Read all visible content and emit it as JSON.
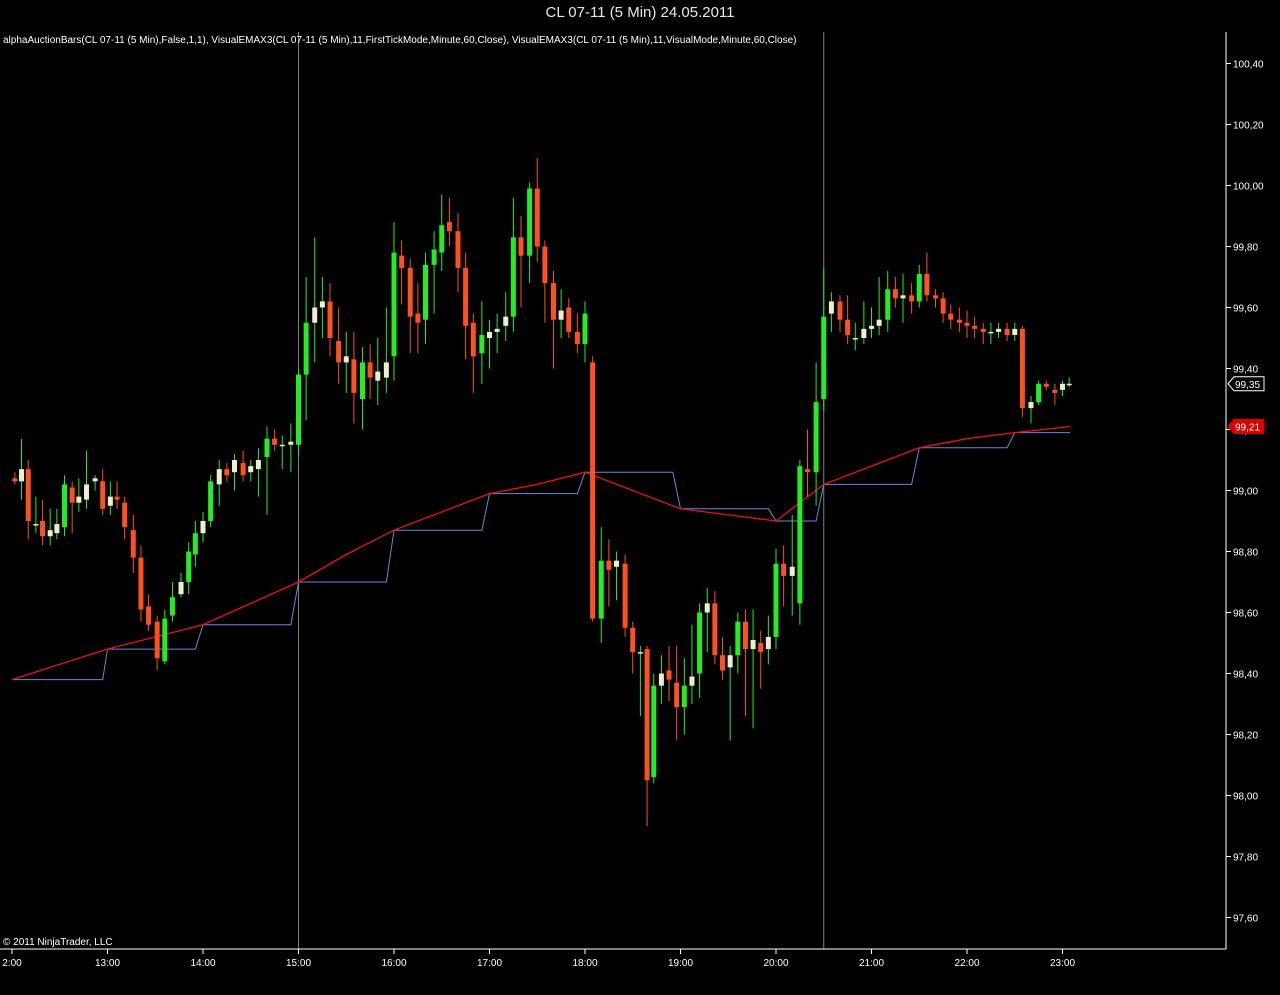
{
  "window": {
    "title": "CL 07-11 (5 Min)  24.05.2011"
  },
  "indicator_label": "alphaAuctionBars(CL 07-11 (5 Min),False,1,1), VisualEMAX3(CL 07-11 (5 Min),11,FirstTickMode,Minute,60,Close), VisualEMAX3(CL 07-11 (5 Min),11,VisualMode,Minute,60,Close)",
  "copyright": "© 2011 NinjaTrader, LLC",
  "colors": {
    "background": "#000000",
    "axis": "#ffffff",
    "session_line": "#808080",
    "bull_strong": "#22ee22",
    "bull_light": "#eeeecc",
    "bear": "#ff5020",
    "ema_first_tick": "#6688dd",
    "ema_visual": "#ee1111",
    "price_marker": "#ffffff",
    "ema_marker": "#dd0000"
  },
  "chart_data": {
    "type": "candlestick",
    "title": "CL 07-11 (5 Min)  24.05.2011",
    "symbol": "CL 07-11",
    "interval": "5 Min",
    "date": "24.05.2011",
    "y_ticks": [
      "100,40",
      "100,20",
      "100,00",
      "99,80",
      "99,60",
      "99,40",
      "99,20",
      "99,00",
      "98,80",
      "98,60",
      "98,40",
      "98,20",
      "98,00",
      "97,80",
      "97,60"
    ],
    "y_tick_values": [
      100.4,
      100.2,
      100.0,
      99.8,
      99.6,
      99.4,
      99.2,
      99.0,
      98.8,
      98.6,
      98.4,
      98.2,
      98.0,
      97.8,
      97.6
    ],
    "x_ticks": [
      "2:00",
      "13:00",
      "14:00",
      "15:00",
      "16:00",
      "17:00",
      "18:00",
      "19:00",
      "20:00",
      "21:00",
      "22:00",
      "23:00"
    ],
    "x_tick_hours": [
      12,
      13,
      14,
      15,
      16,
      17,
      18,
      19,
      20,
      21,
      22,
      23
    ],
    "x_range_hours": [
      12.0,
      24.3
    ],
    "y_range": [
      97.49,
      100.5
    ],
    "session_lines_hours": [
      15.0,
      20.5
    ],
    "last_price": {
      "value": 99.35,
      "label": "99,35"
    },
    "ema_value": {
      "value": 99.21,
      "label": "99,21"
    },
    "ema_first_tick": [
      [
        12.0,
        98.38
      ],
      [
        12.95,
        98.38
      ],
      [
        13.0,
        98.48
      ],
      [
        13.92,
        98.48
      ],
      [
        14.0,
        98.56
      ],
      [
        14.92,
        98.56
      ],
      [
        15.0,
        98.7
      ],
      [
        15.92,
        98.7
      ],
      [
        16.0,
        98.87
      ],
      [
        16.92,
        98.87
      ],
      [
        17.0,
        98.99
      ],
      [
        17.92,
        98.99
      ],
      [
        18.0,
        99.06
      ],
      [
        18.92,
        99.06
      ],
      [
        19.0,
        98.94
      ],
      [
        19.92,
        98.94
      ],
      [
        20.0,
        98.9
      ],
      [
        20.42,
        98.9
      ],
      [
        20.5,
        99.02
      ],
      [
        21.42,
        99.02
      ],
      [
        21.5,
        99.14
      ],
      [
        22.42,
        99.14
      ],
      [
        22.5,
        99.19
      ],
      [
        23.08,
        99.19
      ]
    ],
    "ema_visual": [
      [
        12.0,
        98.38
      ],
      [
        12.5,
        98.43
      ],
      [
        13.0,
        98.48
      ],
      [
        13.5,
        98.52
      ],
      [
        14.0,
        98.56
      ],
      [
        14.5,
        98.63
      ],
      [
        15.0,
        98.7
      ],
      [
        15.5,
        98.79
      ],
      [
        16.0,
        98.87
      ],
      [
        16.5,
        98.93
      ],
      [
        17.0,
        98.99
      ],
      [
        17.5,
        99.02
      ],
      [
        18.0,
        99.06
      ],
      [
        18.5,
        99.0
      ],
      [
        19.0,
        98.94
      ],
      [
        19.5,
        98.92
      ],
      [
        20.0,
        98.9
      ],
      [
        20.5,
        99.02
      ],
      [
        21.0,
        99.08
      ],
      [
        21.5,
        99.14
      ],
      [
        22.0,
        99.17
      ],
      [
        22.5,
        99.19
      ],
      [
        23.08,
        99.21
      ]
    ],
    "candles": [
      {
        "t": 12.03,
        "o": 99.04,
        "h": 99.06,
        "l": 99.02,
        "c": 99.03
      },
      {
        "t": 12.1,
        "o": 99.03,
        "h": 99.17,
        "l": 98.97,
        "c": 99.07
      },
      {
        "t": 12.17,
        "o": 99.07,
        "h": 99.1,
        "l": 98.84,
        "c": 98.9
      },
      {
        "t": 12.25,
        "o": 98.89,
        "h": 98.98,
        "l": 98.86,
        "c": 98.89
      },
      {
        "t": 12.32,
        "o": 98.9,
        "h": 98.97,
        "l": 98.82,
        "c": 98.85
      },
      {
        "t": 12.4,
        "o": 98.85,
        "h": 98.94,
        "l": 98.82,
        "c": 98.87
      },
      {
        "t": 12.47,
        "o": 98.86,
        "h": 98.94,
        "l": 98.84,
        "c": 98.89
      },
      {
        "t": 12.55,
        "o": 98.88,
        "h": 99.05,
        "l": 98.85,
        "c": 99.02
      },
      {
        "t": 12.63,
        "o": 99.01,
        "h": 99.03,
        "l": 98.86,
        "c": 98.96
      },
      {
        "t": 12.7,
        "o": 98.96,
        "h": 99.04,
        "l": 98.93,
        "c": 98.98
      },
      {
        "t": 12.78,
        "o": 98.97,
        "h": 99.13,
        "l": 98.94,
        "c": 99.02
      },
      {
        "t": 12.87,
        "o": 99.03,
        "h": 99.05,
        "l": 99.0,
        "c": 99.04
      },
      {
        "t": 12.95,
        "o": 99.03,
        "h": 99.07,
        "l": 98.92,
        "c": 98.94
      },
      {
        "t": 13.03,
        "o": 98.95,
        "h": 99.03,
        "l": 98.92,
        "c": 98.98
      },
      {
        "t": 13.1,
        "o": 98.98,
        "h": 99.03,
        "l": 98.94,
        "c": 98.97
      },
      {
        "t": 13.18,
        "o": 98.96,
        "h": 98.98,
        "l": 98.84,
        "c": 98.88
      },
      {
        "t": 13.27,
        "o": 98.87,
        "h": 98.92,
        "l": 98.73,
        "c": 98.78
      },
      {
        "t": 13.35,
        "o": 98.78,
        "h": 98.82,
        "l": 98.57,
        "c": 98.61
      },
      {
        "t": 13.43,
        "o": 98.62,
        "h": 98.66,
        "l": 98.54,
        "c": 98.56
      },
      {
        "t": 13.52,
        "o": 98.57,
        "h": 98.59,
        "l": 98.41,
        "c": 98.45
      },
      {
        "t": 13.6,
        "o": 98.44,
        "h": 98.61,
        "l": 98.43,
        "c": 98.58
      },
      {
        "t": 13.68,
        "o": 98.59,
        "h": 98.7,
        "l": 98.57,
        "c": 98.65
      },
      {
        "t": 13.77,
        "o": 98.66,
        "h": 98.73,
        "l": 98.65,
        "c": 98.7
      },
      {
        "t": 13.85,
        "o": 98.7,
        "h": 98.83,
        "l": 98.66,
        "c": 98.8
      },
      {
        "t": 13.92,
        "o": 98.79,
        "h": 98.9,
        "l": 98.75,
        "c": 98.86
      },
      {
        "t": 14.0,
        "o": 98.86,
        "h": 98.93,
        "l": 98.83,
        "c": 98.9
      },
      {
        "t": 14.08,
        "o": 98.9,
        "h": 99.05,
        "l": 98.88,
        "c": 99.03
      },
      {
        "t": 14.17,
        "o": 99.02,
        "h": 99.1,
        "l": 98.95,
        "c": 99.07
      },
      {
        "t": 14.25,
        "o": 99.07,
        "h": 99.09,
        "l": 99.03,
        "c": 99.05
      },
      {
        "t": 14.33,
        "o": 99.06,
        "h": 99.12,
        "l": 99.0,
        "c": 99.1
      },
      {
        "t": 14.42,
        "o": 99.09,
        "h": 99.13,
        "l": 99.03,
        "c": 99.05
      },
      {
        "t": 14.5,
        "o": 99.06,
        "h": 99.1,
        "l": 99.03,
        "c": 99.08
      },
      {
        "t": 14.58,
        "o": 99.07,
        "h": 99.14,
        "l": 98.98,
        "c": 99.1
      },
      {
        "t": 14.67,
        "o": 99.11,
        "h": 99.21,
        "l": 98.92,
        "c": 99.17
      },
      {
        "t": 14.75,
        "o": 99.17,
        "h": 99.2,
        "l": 99.13,
        "c": 99.15
      },
      {
        "t": 14.83,
        "o": 99.15,
        "h": 99.18,
        "l": 99.07,
        "c": 99.15
      },
      {
        "t": 14.92,
        "o": 99.15,
        "h": 99.22,
        "l": 99.06,
        "c": 99.16
      },
      {
        "t": 15.0,
        "o": 99.15,
        "h": 99.4,
        "l": 99.11,
        "c": 99.38
      },
      {
        "t": 15.08,
        "o": 99.38,
        "h": 99.7,
        "l": 99.23,
        "c": 99.55
      },
      {
        "t": 15.17,
        "o": 99.55,
        "h": 99.83,
        "l": 99.42,
        "c": 99.6
      },
      {
        "t": 15.25,
        "o": 99.6,
        "h": 99.7,
        "l": 99.5,
        "c": 99.62
      },
      {
        "t": 15.33,
        "o": 99.62,
        "h": 99.68,
        "l": 99.44,
        "c": 99.5
      },
      {
        "t": 15.42,
        "o": 99.49,
        "h": 99.6,
        "l": 99.35,
        "c": 99.42
      },
      {
        "t": 15.5,
        "o": 99.42,
        "h": 99.52,
        "l": 99.32,
        "c": 99.44
      },
      {
        "t": 15.58,
        "o": 99.43,
        "h": 99.52,
        "l": 99.22,
        "c": 99.32
      },
      {
        "t": 15.67,
        "o": 99.3,
        "h": 99.47,
        "l": 99.2,
        "c": 99.42
      },
      {
        "t": 15.75,
        "o": 99.42,
        "h": 99.48,
        "l": 99.3,
        "c": 99.37
      },
      {
        "t": 15.83,
        "o": 99.36,
        "h": 99.5,
        "l": 99.28,
        "c": 99.39
      },
      {
        "t": 15.92,
        "o": 99.37,
        "h": 99.6,
        "l": 99.32,
        "c": 99.42
      },
      {
        "t": 16.0,
        "o": 99.44,
        "h": 99.88,
        "l": 99.36,
        "c": 99.78
      },
      {
        "t": 16.08,
        "o": 99.77,
        "h": 99.82,
        "l": 99.61,
        "c": 99.73
      },
      {
        "t": 16.17,
        "o": 99.73,
        "h": 99.76,
        "l": 99.45,
        "c": 99.57
      },
      {
        "t": 16.25,
        "o": 99.58,
        "h": 99.68,
        "l": 99.45,
        "c": 99.55
      },
      {
        "t": 16.33,
        "o": 99.56,
        "h": 99.78,
        "l": 99.48,
        "c": 99.74
      },
      {
        "t": 16.42,
        "o": 99.74,
        "h": 99.85,
        "l": 99.58,
        "c": 99.79
      },
      {
        "t": 16.5,
        "o": 99.78,
        "h": 99.97,
        "l": 99.72,
        "c": 99.87
      },
      {
        "t": 16.58,
        "o": 99.88,
        "h": 99.96,
        "l": 99.8,
        "c": 99.85
      },
      {
        "t": 16.67,
        "o": 99.85,
        "h": 99.91,
        "l": 99.65,
        "c": 99.73
      },
      {
        "t": 16.75,
        "o": 99.73,
        "h": 99.78,
        "l": 99.43,
        "c": 99.54
      },
      {
        "t": 16.83,
        "o": 99.55,
        "h": 99.58,
        "l": 99.32,
        "c": 99.44
      },
      {
        "t": 16.92,
        "o": 99.45,
        "h": 99.62,
        "l": 99.35,
        "c": 99.51
      },
      {
        "t": 17.0,
        "o": 99.5,
        "h": 99.56,
        "l": 99.4,
        "c": 99.52
      },
      {
        "t": 17.08,
        "o": 99.52,
        "h": 99.58,
        "l": 99.45,
        "c": 99.53
      },
      {
        "t": 17.17,
        "o": 99.54,
        "h": 99.65,
        "l": 99.49,
        "c": 99.57
      },
      {
        "t": 17.25,
        "o": 99.57,
        "h": 99.96,
        "l": 99.52,
        "c": 99.83
      },
      {
        "t": 17.33,
        "o": 99.83,
        "h": 99.9,
        "l": 99.6,
        "c": 99.77
      },
      {
        "t": 17.42,
        "o": 99.77,
        "h": 100.01,
        "l": 99.68,
        "c": 99.99
      },
      {
        "t": 17.5,
        "o": 99.99,
        "h": 100.09,
        "l": 99.75,
        "c": 99.8
      },
      {
        "t": 17.58,
        "o": 99.8,
        "h": 99.82,
        "l": 99.55,
        "c": 99.68
      },
      {
        "t": 17.67,
        "o": 99.68,
        "h": 99.72,
        "l": 99.4,
        "c": 99.56
      },
      {
        "t": 17.75,
        "o": 99.56,
        "h": 99.66,
        "l": 99.5,
        "c": 99.59
      },
      {
        "t": 17.83,
        "o": 99.6,
        "h": 99.63,
        "l": 99.5,
        "c": 99.52
      },
      {
        "t": 17.92,
        "o": 99.52,
        "h": 99.58,
        "l": 99.45,
        "c": 99.48
      },
      {
        "t": 18.0,
        "o": 99.48,
        "h": 99.62,
        "l": 99.42,
        "c": 99.58
      },
      {
        "t": 18.08,
        "o": 99.42,
        "h": 99.44,
        "l": 98.57,
        "c": 98.58
      },
      {
        "t": 18.17,
        "o": 98.58,
        "h": 98.88,
        "l": 98.5,
        "c": 98.77
      },
      {
        "t": 18.25,
        "o": 98.77,
        "h": 98.84,
        "l": 98.62,
        "c": 98.74
      },
      {
        "t": 18.33,
        "o": 98.75,
        "h": 98.8,
        "l": 98.64,
        "c": 98.77
      },
      {
        "t": 18.42,
        "o": 98.76,
        "h": 98.79,
        "l": 98.52,
        "c": 98.55
      },
      {
        "t": 18.5,
        "o": 98.55,
        "h": 98.57,
        "l": 98.4,
        "c": 98.47
      },
      {
        "t": 18.58,
        "o": 98.47,
        "h": 98.49,
        "l": 98.26,
        "c": 98.47
      },
      {
        "t": 18.65,
        "o": 98.48,
        "h": 98.49,
        "l": 97.9,
        "c": 98.05
      },
      {
        "t": 18.72,
        "o": 98.06,
        "h": 98.4,
        "l": 98.04,
        "c": 98.36
      },
      {
        "t": 18.8,
        "o": 98.36,
        "h": 98.46,
        "l": 98.3,
        "c": 98.4
      },
      {
        "t": 18.88,
        "o": 98.41,
        "h": 98.49,
        "l": 98.31,
        "c": 98.38
      },
      {
        "t": 18.96,
        "o": 98.37,
        "h": 98.49,
        "l": 98.18,
        "c": 98.29
      },
      {
        "t": 19.04,
        "o": 98.29,
        "h": 98.45,
        "l": 98.2,
        "c": 98.36
      },
      {
        "t": 19.12,
        "o": 98.36,
        "h": 98.56,
        "l": 98.3,
        "c": 98.39
      },
      {
        "t": 19.2,
        "o": 98.4,
        "h": 98.63,
        "l": 98.32,
        "c": 98.6
      },
      {
        "t": 19.28,
        "o": 98.6,
        "h": 98.68,
        "l": 98.47,
        "c": 98.63
      },
      {
        "t": 19.36,
        "o": 98.63,
        "h": 98.67,
        "l": 98.43,
        "c": 98.46
      },
      {
        "t": 19.44,
        "o": 98.46,
        "h": 98.52,
        "l": 98.38,
        "c": 98.41
      },
      {
        "t": 19.52,
        "o": 98.42,
        "h": 98.49,
        "l": 98.18,
        "c": 98.46
      },
      {
        "t": 19.6,
        "o": 98.46,
        "h": 98.6,
        "l": 98.4,
        "c": 98.57
      },
      {
        "t": 19.68,
        "o": 98.57,
        "h": 98.61,
        "l": 98.26,
        "c": 98.48
      },
      {
        "t": 19.76,
        "o": 98.48,
        "h": 98.61,
        "l": 98.22,
        "c": 98.51
      },
      {
        "t": 19.84,
        "o": 98.5,
        "h": 98.54,
        "l": 98.35,
        "c": 98.47
      },
      {
        "t": 19.92,
        "o": 98.48,
        "h": 98.59,
        "l": 98.43,
        "c": 98.52
      },
      {
        "t": 20.0,
        "o": 98.52,
        "h": 98.81,
        "l": 98.48,
        "c": 98.76
      },
      {
        "t": 20.08,
        "o": 98.76,
        "h": 98.82,
        "l": 98.62,
        "c": 98.72
      },
      {
        "t": 20.17,
        "o": 98.72,
        "h": 98.92,
        "l": 98.59,
        "c": 98.75
      },
      {
        "t": 20.25,
        "o": 98.63,
        "h": 99.1,
        "l": 98.56,
        "c": 99.08
      },
      {
        "t": 20.33,
        "o": 99.07,
        "h": 99.2,
        "l": 98.98,
        "c": 99.06
      },
      {
        "t": 20.42,
        "o": 99.06,
        "h": 99.42,
        "l": 98.95,
        "c": 99.29
      },
      {
        "t": 20.5,
        "o": 99.3,
        "h": 99.73,
        "l": 99.26,
        "c": 99.57
      },
      {
        "t": 20.58,
        "o": 99.58,
        "h": 99.65,
        "l": 99.52,
        "c": 99.62
      },
      {
        "t": 20.67,
        "o": 99.62,
        "h": 99.64,
        "l": 99.52,
        "c": 99.56
      },
      {
        "t": 20.75,
        "o": 99.56,
        "h": 99.64,
        "l": 99.48,
        "c": 99.51
      },
      {
        "t": 20.83,
        "o": 99.5,
        "h": 99.55,
        "l": 99.46,
        "c": 99.5
      },
      {
        "t": 20.92,
        "o": 99.5,
        "h": 99.62,
        "l": 99.48,
        "c": 99.53
      },
      {
        "t": 21.0,
        "o": 99.53,
        "h": 99.6,
        "l": 99.5,
        "c": 99.54
      },
      {
        "t": 21.08,
        "o": 99.54,
        "h": 99.7,
        "l": 99.51,
        "c": 99.56
      },
      {
        "t": 21.17,
        "o": 99.56,
        "h": 99.72,
        "l": 99.52,
        "c": 99.66
      },
      {
        "t": 21.25,
        "o": 99.66,
        "h": 99.7,
        "l": 99.6,
        "c": 99.63
      },
      {
        "t": 21.33,
        "o": 99.63,
        "h": 99.71,
        "l": 99.55,
        "c": 99.64
      },
      {
        "t": 21.42,
        "o": 99.64,
        "h": 99.68,
        "l": 99.58,
        "c": 99.62
      },
      {
        "t": 21.5,
        "o": 99.62,
        "h": 99.74,
        "l": 99.6,
        "c": 99.71
      },
      {
        "t": 21.58,
        "o": 99.71,
        "h": 99.78,
        "l": 99.62,
        "c": 99.64
      },
      {
        "t": 21.67,
        "o": 99.64,
        "h": 99.66,
        "l": 99.6,
        "c": 99.63
      },
      {
        "t": 21.75,
        "o": 99.63,
        "h": 99.65,
        "l": 99.55,
        "c": 99.58
      },
      {
        "t": 21.83,
        "o": 99.58,
        "h": 99.61,
        "l": 99.53,
        "c": 99.56
      },
      {
        "t": 21.92,
        "o": 99.56,
        "h": 99.6,
        "l": 99.52,
        "c": 99.55
      },
      {
        "t": 22.0,
        "o": 99.55,
        "h": 99.59,
        "l": 99.5,
        "c": 99.54
      },
      {
        "t": 22.08,
        "o": 99.54,
        "h": 99.57,
        "l": 99.5,
        "c": 99.53
      },
      {
        "t": 22.17,
        "o": 99.53,
        "h": 99.55,
        "l": 99.48,
        "c": 99.52
      },
      {
        "t": 22.25,
        "o": 99.52,
        "h": 99.55,
        "l": 99.48,
        "c": 99.52
      },
      {
        "t": 22.33,
        "o": 99.52,
        "h": 99.55,
        "l": 99.5,
        "c": 99.53
      },
      {
        "t": 22.42,
        "o": 99.53,
        "h": 99.55,
        "l": 99.49,
        "c": 99.51
      },
      {
        "t": 22.5,
        "o": 99.51,
        "h": 99.55,
        "l": 99.49,
        "c": 99.53
      },
      {
        "t": 22.58,
        "o": 99.53,
        "h": 99.54,
        "l": 99.24,
        "c": 99.27
      },
      {
        "t": 22.67,
        "o": 99.27,
        "h": 99.31,
        "l": 99.22,
        "c": 99.29
      },
      {
        "t": 22.75,
        "o": 99.29,
        "h": 99.36,
        "l": 99.28,
        "c": 99.35
      },
      {
        "t": 22.83,
        "o": 99.35,
        "h": 99.36,
        "l": 99.33,
        "c": 99.34
      },
      {
        "t": 22.92,
        "o": 99.33,
        "h": 99.35,
        "l": 99.28,
        "c": 99.32
      },
      {
        "t": 23.0,
        "o": 99.33,
        "h": 99.36,
        "l": 99.31,
        "c": 99.35
      },
      {
        "t": 23.07,
        "o": 99.35,
        "h": 99.37,
        "l": 99.34,
        "c": 99.35
      }
    ]
  }
}
